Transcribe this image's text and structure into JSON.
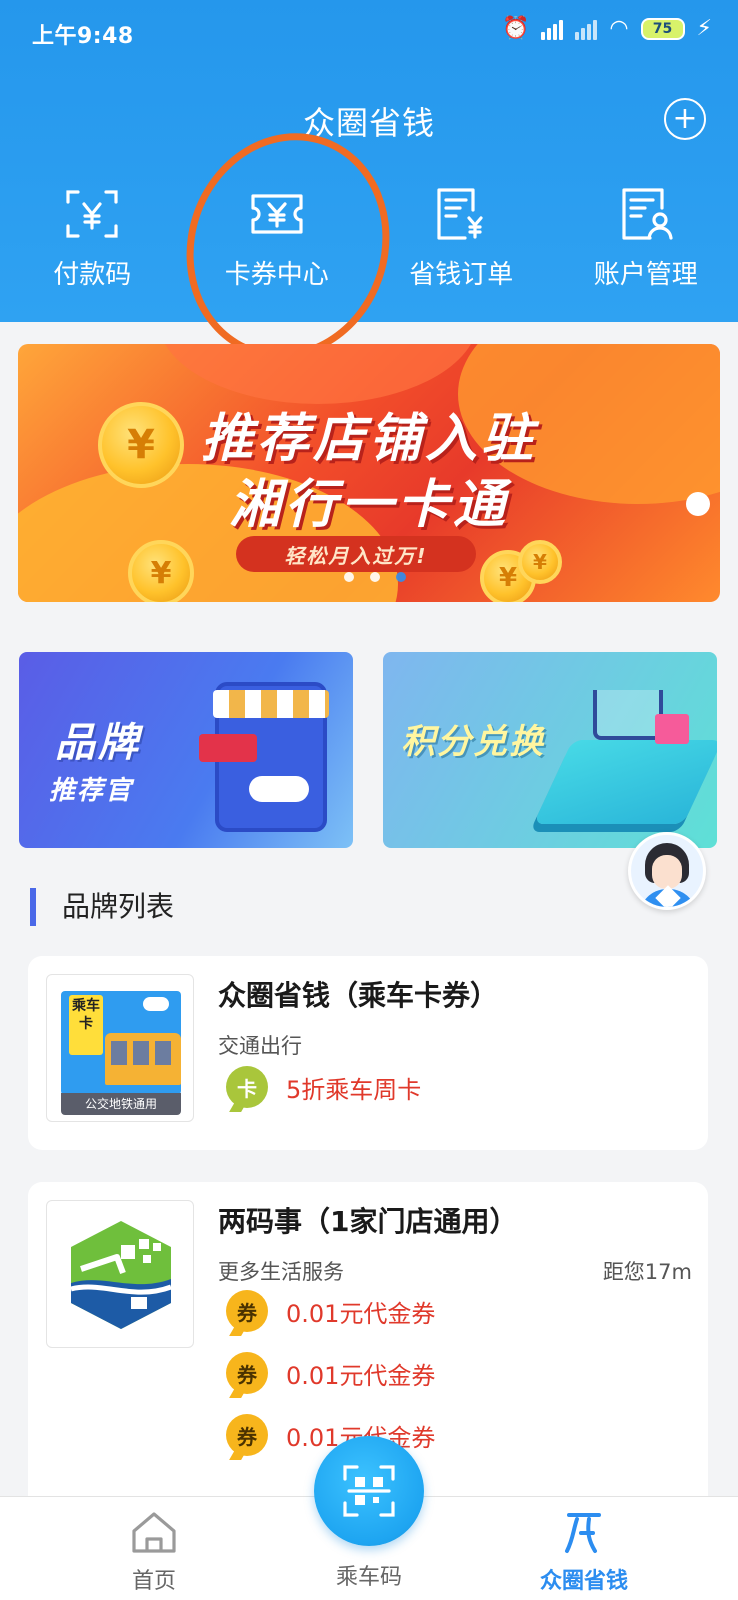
{
  "status_bar": {
    "time": "上午9:48",
    "battery": "75"
  },
  "header": {
    "title": "众圈省钱",
    "add_icon": "plus-circle-icon"
  },
  "quick_nav": [
    {
      "label": "付款码",
      "icon": "scan-yen-icon"
    },
    {
      "label": "卡券中心",
      "icon": "ticket-yen-icon"
    },
    {
      "label": "省钱订单",
      "icon": "order-yen-icon"
    },
    {
      "label": "账户管理",
      "icon": "account-card-icon"
    }
  ],
  "banner": {
    "line1": "推荐店铺入驻",
    "line2": "湘行一卡通",
    "pill": "轻松月入过万!",
    "slides": 3,
    "active_slide": 3
  },
  "promos": [
    {
      "title": "品牌",
      "subtitle": "推荐官"
    },
    {
      "title": "积分兑换"
    }
  ],
  "brand_list": {
    "title": "品牌列表",
    "items": [
      {
        "name": "众圈省钱（乘车卡券）",
        "category": "交通出行",
        "distance": "",
        "logo": {
          "tag": "乘车卡",
          "footer": "公交地铁通用"
        },
        "coupons": [
          {
            "badge": "卡",
            "text": "5折乘车周卡"
          }
        ]
      },
      {
        "name": "两码事（1家门店通用）",
        "category": "更多生活服务",
        "distance": "距您17m",
        "coupons": [
          {
            "badge": "券",
            "text": "0.01元代金券"
          },
          {
            "badge": "券",
            "text": "0.01元代金券"
          },
          {
            "badge": "券",
            "text": "0.01元代金券"
          }
        ]
      }
    ]
  },
  "bottom_nav": [
    {
      "label": "首页",
      "icon": "home-icon"
    },
    {
      "label": "乘车码",
      "icon": "qr-scan-icon"
    },
    {
      "label": "众圈省钱",
      "icon": "zq-logo-icon",
      "active": true
    }
  ],
  "colors": {
    "header": "#2597ec",
    "accent": "#2c8df0",
    "coupon_red": "#e0392b",
    "highlight_ring": "#f06b22"
  }
}
